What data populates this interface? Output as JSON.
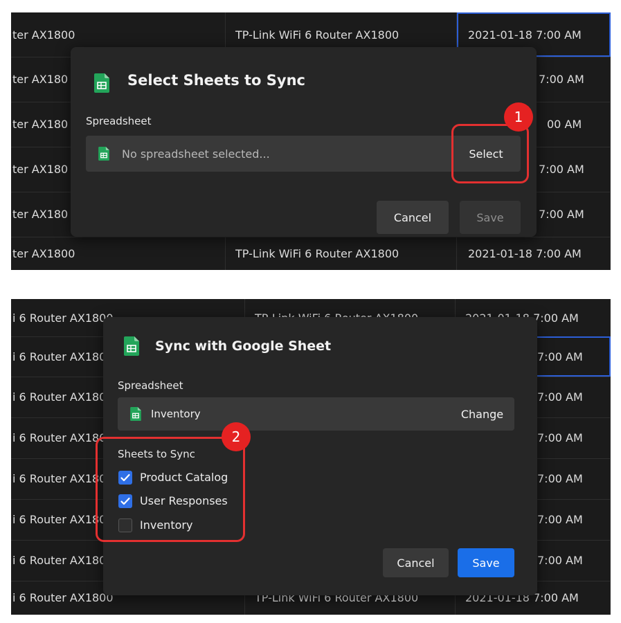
{
  "panel1": {
    "bg_rows": [
      {
        "c1": "ter AX1800",
        "c2": "TP-Link WiFi 6 Router AX1800",
        "c3": "2021-01-18 7:00 AM"
      },
      {
        "c1": "ter AX180",
        "c2": "",
        "c3": "7:00 AM"
      },
      {
        "c1": "ter AX180",
        "c2": "",
        "c3": "00 AM"
      },
      {
        "c1": "ter AX180",
        "c2": "",
        "c3": "7:00 AM"
      },
      {
        "c1": "ter AX180",
        "c2": "",
        "c3": "7:00 AM"
      },
      {
        "c1": "ter AX1800",
        "c2": "TP-Link WiFi 6 Router AX1800",
        "c3": "2021-01-18 7:00 AM"
      }
    ],
    "modal": {
      "title": "Select Sheets to Sync",
      "spreadsheet_label": "Spreadsheet",
      "placeholder": "No spreadsheet selected...",
      "select_label": "Select",
      "cancel_label": "Cancel",
      "save_label": "Save"
    },
    "badge": "1"
  },
  "panel2": {
    "bg_rows": [
      {
        "c1": "i 6 Router AX1800",
        "c2": "TP-Link WiFi 6 Router AX1800",
        "c3": "2021-01-18 7:00 AM"
      },
      {
        "c1": "i 6 Router AX180",
        "c2": "",
        "c3": "7:00 AM"
      },
      {
        "c1": "i 6 Router AX180",
        "c2": "",
        "c3": "7:00 AM"
      },
      {
        "c1": "i 6 Router AX180",
        "c2": "",
        "c3": "7:00 AM"
      },
      {
        "c1": "i 6 Router AX180",
        "c2": "",
        "c3": "7:00 AM"
      },
      {
        "c1": "i 6 Router AX180",
        "c2": "",
        "c3": "7:00 AM"
      },
      {
        "c1": "i 6 Router AX180",
        "c2": "",
        "c3": "7:00 AM"
      },
      {
        "c1": "i 6 Router AX1800",
        "c2": "TP-Link WiFi 6 Router AX1800",
        "c3": "2021-01-18 7:00 AM"
      }
    ],
    "modal": {
      "title": "Sync with Google Sheet",
      "spreadsheet_label": "Spreadsheet",
      "spreadsheet_value": "Inventory",
      "change_label": "Change",
      "sheets_label": "Sheets to Sync",
      "sheets": [
        {
          "label": "Product Catalog",
          "checked": true
        },
        {
          "label": "User Responses",
          "checked": true
        },
        {
          "label": "Inventory",
          "checked": false
        }
      ],
      "cancel_label": "Cancel",
      "save_label": "Save"
    },
    "badge": "2"
  },
  "colors": {
    "accent_blue": "#1a6ee8",
    "annotation_red": "#e33030",
    "sheets_green": "#23a55a"
  },
  "icons": {
    "sheet": "google-sheets-icon",
    "check": "checkmark-icon"
  }
}
